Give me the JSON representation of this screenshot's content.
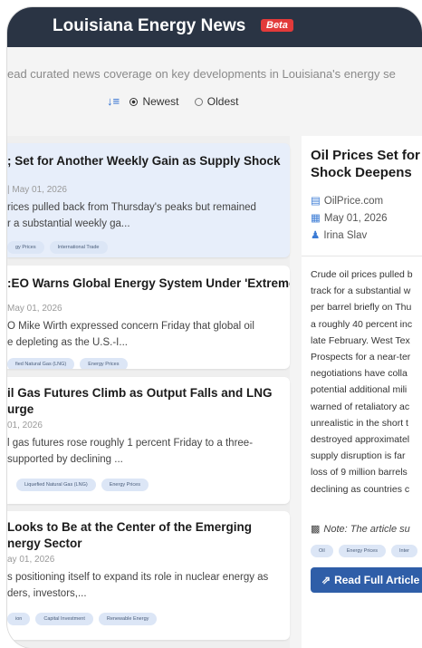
{
  "header": {
    "title": "Louisiana Energy News",
    "badge": "Beta"
  },
  "subtitle": "ead curated news coverage on key developments in Louisiana's energy se",
  "sort": {
    "icon": "sort-desc-icon",
    "newest": "Newest",
    "oldest": "Oldest",
    "selected": "Newest"
  },
  "articles": [
    {
      "title": "; Set for Another Weekly Gain as Supply Shock",
      "date": "| May 01, 2026",
      "snippet": [
        "rices pulled back from Thursday's peaks but remained",
        "r a substantial weekly ga..."
      ],
      "tags": [
        "gy Prices",
        "International Trade"
      ]
    },
    {
      "title": ":EO Warns Global Energy System Under 'Extreme",
      "date": "May 01, 2026",
      "snippet": [
        "O Mike Wirth expressed concern Friday that global oil",
        "e depleting as the U.S.-I..."
      ],
      "tags": [
        "fied Natural Gas (LNG)",
        "Energy Prices"
      ]
    },
    {
      "title": [
        "il Gas Futures Climb as Output Falls and LNG",
        "urge"
      ],
      "date": "01, 2026",
      "snippet": [
        "l gas futures rose roughly 1 percent Friday to a three-",
        "supported by declining ..."
      ],
      "tags": [
        "Liquefied Natural Gas (LNG)",
        "Energy Prices"
      ]
    },
    {
      "title": [
        "Looks to Be at the Center of the Emerging",
        "nergy Sector"
      ],
      "date": "ay 01, 2026",
      "snippet": [
        "s positioning itself to expand its role in nuclear energy as",
        "ders, investors,..."
      ],
      "tags": [
        "ion",
        "Capital Investment",
        "Renewable Energy"
      ]
    }
  ],
  "detail": {
    "title": [
      "Oil Prices Set for A",
      "Shock Deepens"
    ],
    "source": "OilPrice.com",
    "date": "May 01, 2026",
    "author": "Irina Slav",
    "body": [
      "Crude oil prices pulled b",
      "track for a substantial w",
      "per barrel briefly on Thu",
      "a roughly 40 percent inc",
      "late February. West Tex",
      "Prospects for a near-ter",
      "negotiations have colla",
      "potential additional mili",
      "warned of retaliatory ac",
      "unrealistic in the short t",
      "destroyed approximatel",
      "supply disruption is far",
      "loss of 9 million barrels",
      "declining as countries c"
    ],
    "note": "Note: The article su",
    "tags": [
      "Oil",
      "Energy Prices",
      "Inter"
    ],
    "read_button": "Read Full Article"
  },
  "colors": {
    "header_bg": "#2a3444",
    "accent": "#2f5ea8",
    "badge": "#e23a3a",
    "selected_card": "#e7eefa"
  }
}
